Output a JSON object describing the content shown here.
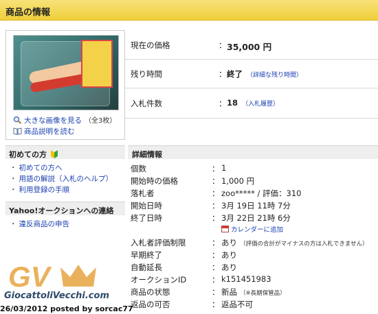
{
  "header": {
    "title": "商品の情報"
  },
  "image_panel": {
    "enlarge_label": "大きな画像を見る",
    "image_count": "（全3枚）",
    "description_label": "商品説明を読む"
  },
  "summary": [
    {
      "label": "現在の価格",
      "value": "35,000 円",
      "sub": ""
    },
    {
      "label": "残り時間",
      "value": "終了",
      "sub": "（詳細な残り時間）"
    },
    {
      "label": "入札件数",
      "value": "18",
      "sub": "（入札履歴）"
    }
  ],
  "beginner": {
    "heading": "初めての方",
    "links": [
      "初めての方へ",
      "用語の解説（入札のヘルプ）",
      "利用登録の手順"
    ]
  },
  "contact": {
    "heading": "Yahoo!オークションへの連絡",
    "links": [
      "違反商品の申告"
    ]
  },
  "details": {
    "heading": "詳細情報",
    "calendar_link": "カレンダーに追加",
    "rows": [
      {
        "label": "個数",
        "value": "1",
        "note": ""
      },
      {
        "label": "開始時の価格",
        "value": "1,000 円",
        "note": ""
      },
      {
        "label": "落札者",
        "value": "zoo***** / 評価：310",
        "note": ""
      },
      {
        "label": "開始日時",
        "value": "3月 19日 11時 7分",
        "note": ""
      },
      {
        "label": "終了日時",
        "value": "3月 22日 21時 6分",
        "note": ""
      },
      {
        "label": "入札者評価制限",
        "value": "あり",
        "note": "（評価の合計がマイナスの方は入札できません）"
      },
      {
        "label": "早期終了",
        "value": "あり",
        "note": ""
      },
      {
        "label": "自動延長",
        "value": "あり",
        "note": ""
      },
      {
        "label": "オークションID",
        "value": "k151451983",
        "note": ""
      },
      {
        "label": "商品の状態",
        "value": "新品",
        "note": "（※長期保管品）"
      },
      {
        "label": "返品の可否",
        "value": "返品不可",
        "note": ""
      }
    ]
  },
  "watermark": {
    "logo": "GV",
    "site": "GiocattoliVecchi.com",
    "posted": "26/03/2012 posted by sorcac77"
  },
  "colors": {
    "header": "#efcf3a",
    "link": "#1a3fb0",
    "watermark": "#e8a94a"
  }
}
